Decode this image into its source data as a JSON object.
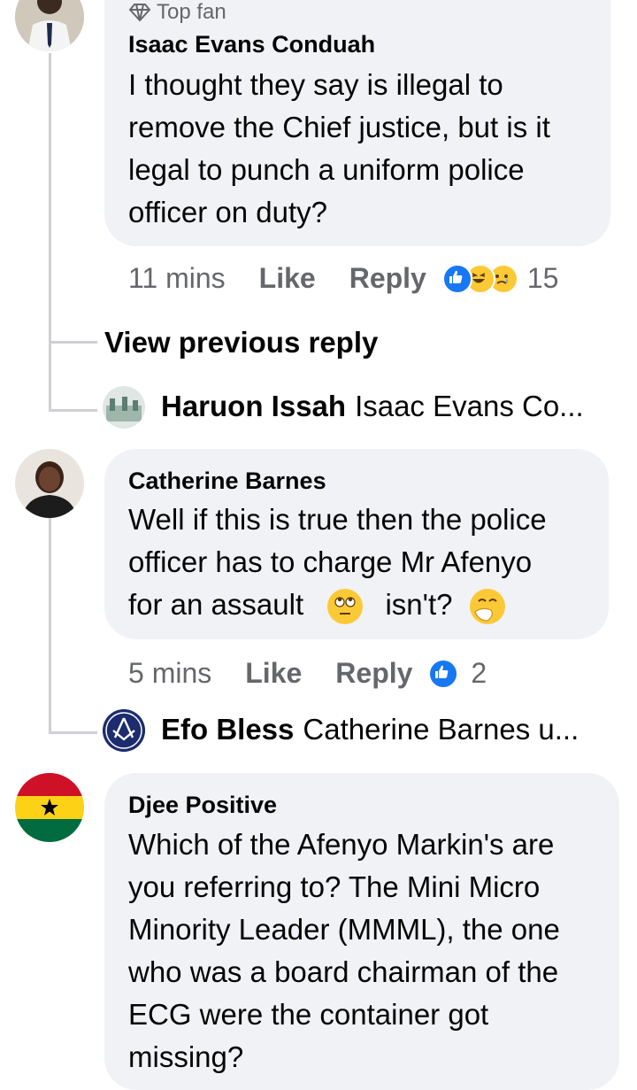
{
  "comments": [
    {
      "badge": "Top fan",
      "name": "Isaac Evans Conduah",
      "lines": [
        "I thought they say is illegal to",
        "remove the Chief justice, but is it",
        "legal to punch a uniform police",
        "officer on duty?"
      ],
      "time": "11 mins",
      "like_label": "Like",
      "reply_label": "Reply",
      "reaction_count": "15",
      "view_previous": "View previous reply",
      "reply": {
        "name": "Haruon Issah",
        "text": "Isaac Evans Co..."
      }
    },
    {
      "name": "Catherine Barnes",
      "lines": [
        "Well if this is true then the police",
        "officer has to charge Mr Afenyo"
      ],
      "line3_a": "for an assault",
      "line3_b": "isn't?",
      "time": "5 mins",
      "like_label": "Like",
      "reply_label": "Reply",
      "reaction_count": "2",
      "reply": {
        "name": "Efo Bless",
        "text": "Catherine Barnes u..."
      }
    },
    {
      "name": "Djee Positive",
      "lines": [
        "Which of the Afenyo Markin's are",
        "you referring to? The Mini Micro",
        "Minority Leader (MMML), the one",
        "who was a board chairman of the",
        "ECG were the container got",
        "missing?"
      ]
    }
  ],
  "colors": {
    "bubble": "#f0f2f5",
    "meta": "#65676b",
    "like_blue": "#1877f2",
    "thread": "#ced0d4"
  },
  "icons": {
    "badge": "diamond-icon",
    "reactions": [
      "like-reaction-icon",
      "haha-reaction-icon",
      "sad-reaction-icon"
    ]
  }
}
